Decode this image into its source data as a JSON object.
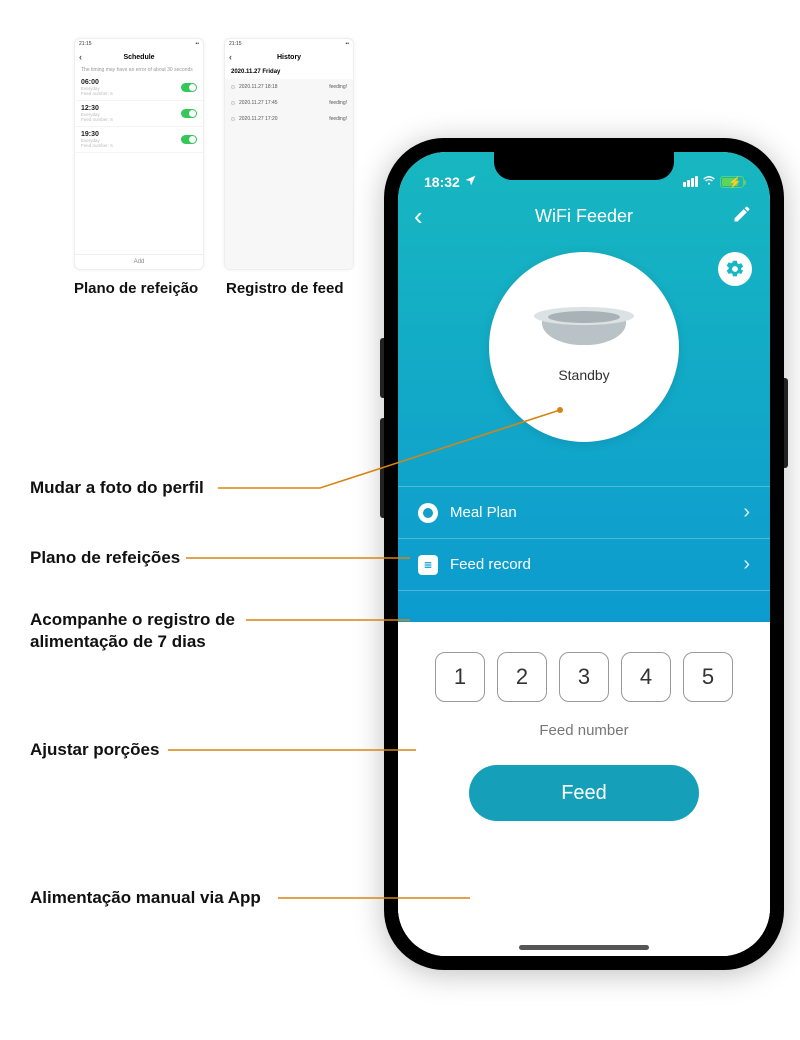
{
  "thumbnails": {
    "schedule": {
      "statusbar_time": "21:15",
      "title": "Schedule",
      "subtitle": "The timing may have an error of about 30 seconds",
      "rows": [
        {
          "time": "06:00",
          "meta1": "Everyday",
          "meta2": "Feed number: 6"
        },
        {
          "time": "12:30",
          "meta1": "Everyday",
          "meta2": "Feed number: 6"
        },
        {
          "time": "19:30",
          "meta1": "Everyday",
          "meta2": "Feed number: 6"
        }
      ],
      "add": "Add",
      "label": "Plano de refeição"
    },
    "history": {
      "statusbar_time": "21:15",
      "title": "History",
      "date_header": "2020.11.27 Friday",
      "rows": [
        {
          "ts": "2020.11.27 18:18",
          "status": "feeding!"
        },
        {
          "ts": "2020.11.27 17:45",
          "status": "feeding!"
        },
        {
          "ts": "2020.11.27 17:20",
          "status": "feeding!"
        }
      ],
      "label": "Registro de feed"
    }
  },
  "phone": {
    "statusbar": {
      "time": "18:32"
    },
    "app_title": "WiFi Feeder",
    "avatar_status": "Standby",
    "menu": {
      "meal_plan": "Meal Plan",
      "feed_record": "Feed record"
    },
    "portions": [
      "1",
      "2",
      "3",
      "4",
      "5"
    ],
    "feed_number_label": "Feed number",
    "feed_button": "Feed"
  },
  "callouts": {
    "profile": "Mudar a foto do perfil",
    "meal_plan": "Plano de refeições",
    "feed_record_1": "Acompanhe o registro de",
    "feed_record_2": "alimentação de 7 dias",
    "portions": "Ajustar porções",
    "manual_feed": "Alimentação manual via App"
  }
}
